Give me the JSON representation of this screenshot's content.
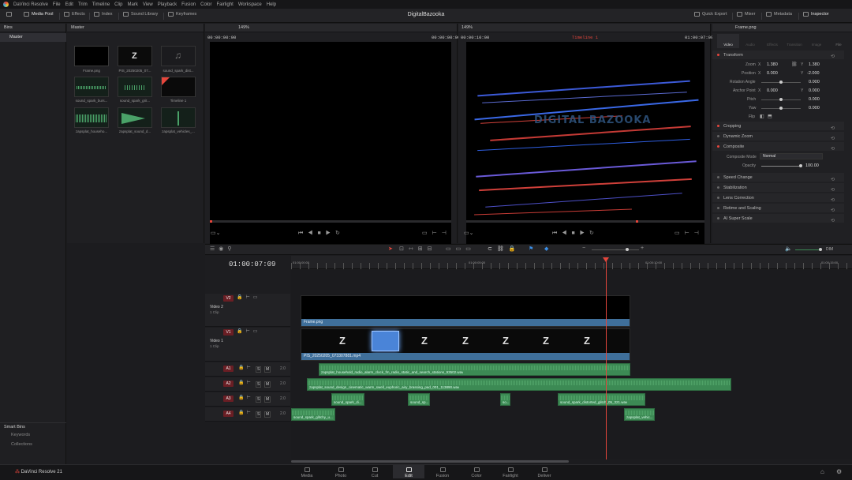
{
  "app": {
    "name": "DaVinci Resolve 21",
    "project": "DigitalBazooka"
  },
  "menu": [
    "DaVinci Resolve",
    "File",
    "Edit",
    "Trim",
    "Timeline",
    "Clip",
    "Mark",
    "View",
    "Playback",
    "Fusion",
    "Color",
    "Fairlight",
    "Workspace",
    "Help"
  ],
  "toolbar": {
    "media_pool": "Media Pool",
    "effects": "Effects",
    "index": "Index",
    "sound_library": "Sound Library",
    "keyframes": "Keyframes",
    "quick_export": "Quick Export",
    "mixer": "Mixer",
    "metadata": "Metadata",
    "inspector": "Inspector"
  },
  "bins": {
    "header": "Bins",
    "master": "Master",
    "smart_bins": "Smart Bins",
    "keywords": "Keywords",
    "collections": "Collections"
  },
  "media_pool": {
    "header": "Master",
    "items": [
      {
        "label": "Frame.png"
      },
      {
        "label": "PIS_20250205_07..."
      },
      {
        "label": "sound_spark_dist..."
      },
      {
        "label": "sound_spark_burs..."
      },
      {
        "label": "sound_spark_grit..."
      },
      {
        "label": "Timeline 1"
      },
      {
        "label": "zapsplat_househo..."
      },
      {
        "label": "zapsplat_sound_d..."
      },
      {
        "label": "zapsplat_vehicles_..."
      }
    ]
  },
  "source_viewer": {
    "zoom": "149%",
    "tc_left": "00:00:00:00",
    "tc_right": "00:00:00:00"
  },
  "timeline_viewer": {
    "zoom": "149%",
    "tc_left": "00:00:10:00",
    "timeline_name": "Timeline 1",
    "tc_right": "01:00:07:09",
    "overlay_text": "DIGITAL BAZOOKA"
  },
  "inspector": {
    "clip_name": "Frame.png",
    "tabs": [
      "Video",
      "Audio",
      "Effects",
      "Transition",
      "Image",
      "File"
    ],
    "transform": {
      "title": "Transform",
      "zoom_label": "Zoom",
      "zoom_x": "1.380",
      "zoom_y": "1.380",
      "position_label": "Position",
      "pos_x": "0.000",
      "pos_y": "-2.000",
      "rotation_label": "Rotation Angle",
      "rotation": "0.000",
      "anchor_label": "Anchor Point",
      "anchor_x": "0.000",
      "anchor_y": "0.000",
      "pitch_label": "Pitch",
      "pitch": "0.000",
      "yaw_label": "Yaw",
      "yaw": "0.000",
      "flip_label": "Flip",
      "x": "X",
      "y": "Y"
    },
    "cropping": "Cropping",
    "dynamic_zoom": "Dynamic Zoom",
    "composite": {
      "title": "Composite",
      "mode_label": "Composite Mode",
      "mode": "Normal",
      "opacity_label": "Opacity",
      "opacity": "100.00"
    },
    "sections": [
      "Speed Change",
      "Stabilization",
      "Lens Correction",
      "Retime and Scaling",
      "AI Super Scale"
    ]
  },
  "timeline": {
    "timecode": "01:00:07:09",
    "ruler": [
      "01:00:00:00",
      "01:00:05:00",
      "01:00:10:00",
      "01:00:15:00"
    ],
    "tracks": {
      "v2": {
        "badge": "V2",
        "name": "Video 2",
        "count": "1 Clip"
      },
      "v1": {
        "badge": "V1",
        "name": "Video 1",
        "count": "1 Clip"
      },
      "a1": {
        "badge": "A1",
        "level": "2.0"
      },
      "a2": {
        "badge": "A2",
        "level": "2.0"
      },
      "a3": {
        "badge": "A3",
        "level": "2.0"
      },
      "a4": {
        "badge": "A4",
        "level": "2.0"
      }
    },
    "clips": {
      "frame": "Frame.png",
      "pis": "PIS_20250205_073307881.mp4",
      "a1": "zapsplat_household_radio_alarm_clock_fm_radio_static_and_search_stations_93502.wav",
      "a2": "zapsplat_sound_design_cinematic_warm_swell_euphoric_airy_brassing_pad_001_113890.wav",
      "a3a": "sound_spark_di...",
      "a3b": "sound_sp...",
      "a3c": "so...",
      "a3d": "sound_spark_distorted_glitch_05_321.wav",
      "a4a": "sound_spark_glitchy_u...",
      "a4b": "zapsplat_vehic..."
    },
    "mute_label": "M",
    "solo_label": "S",
    "dim_label": "DIM"
  },
  "pages": [
    "Media",
    "Photo",
    "Cut",
    "Edit",
    "Fusion",
    "Color",
    "Fairlight",
    "Deliver"
  ],
  "colors": {
    "accent": "#e5463c",
    "audio_clip": "#3c8a54",
    "video_clip": "#3f6f9a"
  }
}
